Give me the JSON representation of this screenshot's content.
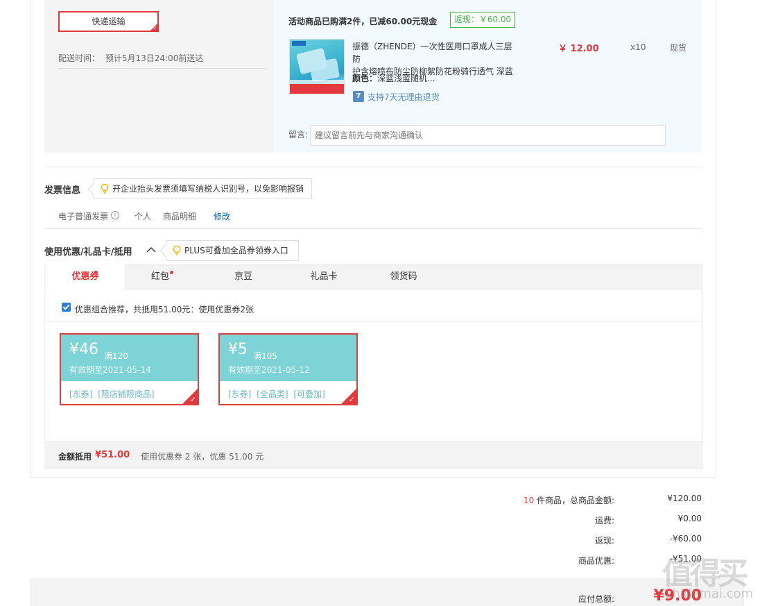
{
  "shipping": {
    "method": "快递运输",
    "delivery_label": "配送时间：",
    "delivery_value": "预计5月13日24:00前送达"
  },
  "promo": {
    "text": "活动商品已购满2件，已减60.00元现金",
    "cashback": "返现：￥60.00"
  },
  "product": {
    "name_line1": "振德（ZHENDE）一次性医用口罩成人三层防",
    "name_line2": "护含熔喷布防尘防柳絮防花粉骑行透气 深蓝",
    "color_label": "颜色：",
    "color_value": "深蓝浅蓝随机...",
    "price": "￥ 12.00",
    "qty": "x10",
    "stock": "现货",
    "return_badge": "7",
    "return_text": "支持7天无理由退货"
  },
  "message": {
    "label": "留言:",
    "placeholder": "建议留言前先与商家沟通确认"
  },
  "invoice": {
    "title": "发票信息",
    "tip": "开企业抬头发票须填写纳税人识别号，以免影响报销",
    "type": "电子普通发票",
    "info_icon": "i",
    "holder": "个人",
    "content": "商品明细",
    "edit": "修改"
  },
  "discount": {
    "title": "使用优惠/礼品卡/抵用",
    "tip": "PLUS可叠加全品券领券入口",
    "tabs": [
      "优惠券",
      "红包",
      "京豆",
      "礼品卡",
      "领货码"
    ],
    "recommend_text": "优惠组合推荐，共抵用51.00元：使用优惠券2张",
    "coupons": [
      {
        "amount": "¥46",
        "condition": "满120",
        "valid": "有效期至2021-05-14",
        "tags": [
          "[东券]",
          "[限店铺限商品]"
        ]
      },
      {
        "amount": "¥5",
        "condition": "满105",
        "valid": "有效期至2021-05-12",
        "tags": [
          "[东券]",
          "[全品类]",
          "[可叠加]"
        ]
      }
    ],
    "sum_label": "金额抵用",
    "sum_value": "¥51.00",
    "sum_desc": "使用优惠券 2 张，优惠 51.00 元"
  },
  "totals": {
    "count": "10",
    "count_label": "件商品，总商品金额:",
    "goods_amount": "¥120.00",
    "freight_label": "运费:",
    "freight": "¥0.00",
    "cashback_label": "返现:",
    "cashback": "-¥60.00",
    "discount_label": "商品优惠:",
    "discount": "-¥51.00",
    "payable_label": "应付总额:",
    "payable": "¥9.00"
  },
  "colors": {
    "accent": "#e4393c",
    "coupon_bg": "#7dd3d6",
    "link": "#005ea7",
    "cashback_green": "#3eb43e"
  },
  "watermark": {
    "big": "值得买",
    "small": "zhidemai.com"
  }
}
